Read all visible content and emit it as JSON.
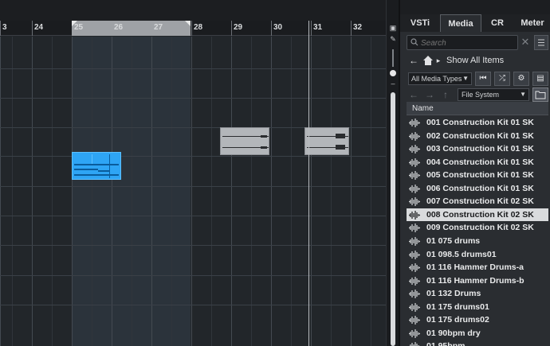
{
  "ruler": {
    "bars": [
      "3",
      "24",
      "25",
      "26",
      "27",
      "28",
      "29",
      "30",
      "31",
      "32"
    ]
  },
  "panel": {
    "tabs": [
      {
        "label": "VSTi",
        "active": false
      },
      {
        "label": "Media",
        "active": true
      },
      {
        "label": "CR",
        "active": false
      },
      {
        "label": "Meter",
        "active": false
      }
    ],
    "search": {
      "placeholder": "Search",
      "value": ""
    },
    "navigation": {
      "label": "Show All Items"
    },
    "filters": {
      "media_types": "All Media Types",
      "location": "File System"
    },
    "list_header": "Name",
    "items": [
      {
        "name": "001 Construction Kit 01 SK",
        "selected": false
      },
      {
        "name": "002 Construction Kit 01 SK",
        "selected": false
      },
      {
        "name": "003 Construction Kit 01 SK",
        "selected": false
      },
      {
        "name": "004 Construction Kit 01 SK",
        "selected": false
      },
      {
        "name": "005 Construction Kit 01 SK",
        "selected": false
      },
      {
        "name": "006 Construction Kit 01 SK",
        "selected": false
      },
      {
        "name": "007 Construction Kit 02 SK",
        "selected": false
      },
      {
        "name": "008 Construction Kit 02 SK",
        "selected": true
      },
      {
        "name": "009 Construction Kit 02 SK",
        "selected": false
      },
      {
        "name": "01 075 drums",
        "selected": false
      },
      {
        "name": "01 098.5 drums01",
        "selected": false
      },
      {
        "name": "01 116 Hammer Drums-a",
        "selected": false
      },
      {
        "name": "01 116 Hammer Drums-b",
        "selected": false
      },
      {
        "name": "01 132 Drums",
        "selected": false
      },
      {
        "name": "01 175 drums01",
        "selected": false
      },
      {
        "name": "01 175 drums02",
        "selected": false
      },
      {
        "name": "01 90bpm dry",
        "selected": false
      },
      {
        "name": "01 95bpm",
        "selected": false
      }
    ]
  },
  "colors": {
    "midi_event": "#2ea5f5",
    "audio_event": "#b3b6ba",
    "selected_row": "#d9dbdd"
  },
  "icons": {
    "back": "back-arrow-icon",
    "home": "home-icon",
    "waveform": "waveform-icon"
  }
}
